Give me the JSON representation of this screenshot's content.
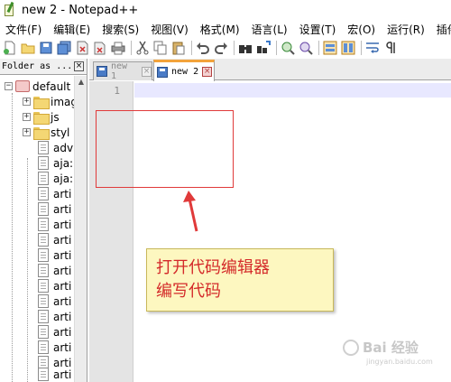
{
  "window": {
    "title": "new 2 - Notepad++"
  },
  "menu": [
    "文件(F)",
    "编辑(E)",
    "搜索(S)",
    "视图(V)",
    "格式(M)",
    "语言(L)",
    "设置(T)",
    "宏(O)",
    "运行(R)",
    "插件(P"
  ],
  "toolbar": {
    "icons": [
      "new-file-icon",
      "open-file-icon",
      "save-icon",
      "save-all-icon",
      "close-icon",
      "close-all-icon",
      "print-icon",
      "cut-icon",
      "copy-icon",
      "paste-icon",
      "undo-icon",
      "redo-icon",
      "find-icon",
      "replace-icon",
      "zoom-in-icon",
      "zoom-out-icon",
      "sync-vertical-icon",
      "sync-horizontal-icon",
      "word-wrap-icon",
      "show-all-chars-icon"
    ]
  },
  "panel": {
    "title": "Folder as ...",
    "close_glyph": "×",
    "tree": [
      {
        "label": "default",
        "type": "root",
        "expander": "−"
      },
      {
        "label": "imag",
        "type": "folder",
        "expander": "+"
      },
      {
        "label": "js",
        "type": "folder",
        "expander": "+"
      },
      {
        "label": "styl",
        "type": "folder",
        "expander": "+"
      },
      {
        "label": "adv",
        "type": "file"
      },
      {
        "label": "aja:",
        "type": "file"
      },
      {
        "label": "aja:",
        "type": "file"
      },
      {
        "label": "arti",
        "type": "file"
      },
      {
        "label": "arti",
        "type": "file"
      },
      {
        "label": "arti",
        "type": "file"
      },
      {
        "label": "arti",
        "type": "file"
      },
      {
        "label": "arti",
        "type": "file"
      },
      {
        "label": "arti",
        "type": "file"
      },
      {
        "label": "arti",
        "type": "file"
      },
      {
        "label": "arti",
        "type": "file"
      },
      {
        "label": "arti",
        "type": "file"
      },
      {
        "label": "arti",
        "type": "file"
      },
      {
        "label": "arti",
        "type": "file"
      },
      {
        "label": "arti",
        "type": "file"
      },
      {
        "label": "arti",
        "type": "file"
      }
    ]
  },
  "tabs": [
    {
      "label": "new 1",
      "active": false,
      "close_glyph": "×"
    },
    {
      "label": "new 2",
      "active": true,
      "close_glyph": "×"
    }
  ],
  "editor": {
    "line_number": "1",
    "content": ""
  },
  "annotation": {
    "callout_line1": "打开代码编辑器",
    "callout_line2": "编写代码",
    "box_color": "#e03a3a",
    "text_color": "#d42a2a"
  },
  "watermark": {
    "main": "Bai 经验",
    "sub": "jingyan.baidu.com"
  },
  "colors": {
    "active_tab_accent": "#f3a33b",
    "current_line": "#e8e8ff",
    "callout_bg": "#fdf7c0"
  }
}
